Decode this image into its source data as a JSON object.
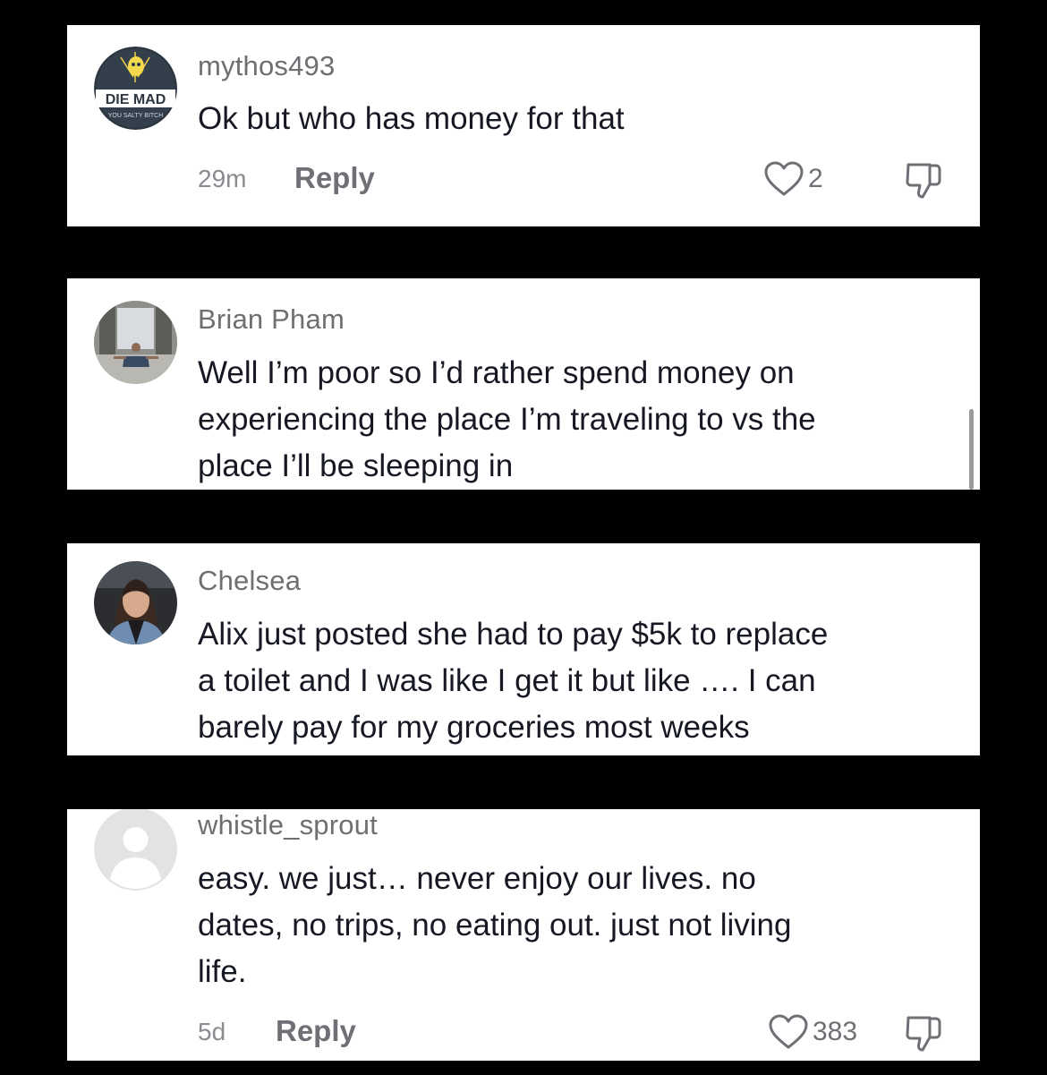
{
  "comments": [
    {
      "username": "mythos493",
      "text_lines": [
        "Ok but who has money for that"
      ],
      "time": "29m",
      "reply_label": "Reply",
      "like_count": "2",
      "avatar": {
        "type": "logo",
        "lettering": "DIE MAD",
        "sub_lettering": "YOU SALTY BITCH",
        "colors": {
          "bg": "#2f3a44",
          "text": "#ffffff"
        }
      }
    },
    {
      "username": "Brian Pham",
      "text_lines": [
        "Well I’m poor so I’d rather spend money on",
        "experiencing the place I’m traveling to vs the",
        "place I’ll be sleeping in"
      ],
      "avatar": {
        "type": "photo",
        "description_icon": "person-photo"
      }
    },
    {
      "username": "Chelsea",
      "text_lines": [
        "Alix just posted she had to pay $5k to replace",
        "a toilet and I was like I get it but like …. I can",
        "barely pay for my groceries most weeks"
      ],
      "avatar": {
        "type": "photo",
        "description_icon": "person-photo"
      }
    },
    {
      "username": "whistle_sprout",
      "text_lines": [
        "easy. we just… never enjoy our lives. no",
        "dates, no trips, no eating out. just not living",
        "life."
      ],
      "time": "5d",
      "reply_label": "Reply",
      "like_count": "383",
      "avatar": {
        "type": "default",
        "description_icon": "default-user-icon"
      }
    }
  ],
  "icons": {
    "like": "heart-outline-icon",
    "dislike": "thumbs-down-icon"
  },
  "colors": {
    "background": "#000000",
    "card": "#ffffff",
    "username": "#6f6f73",
    "text": "#161823",
    "meta": "#8a8b91"
  }
}
